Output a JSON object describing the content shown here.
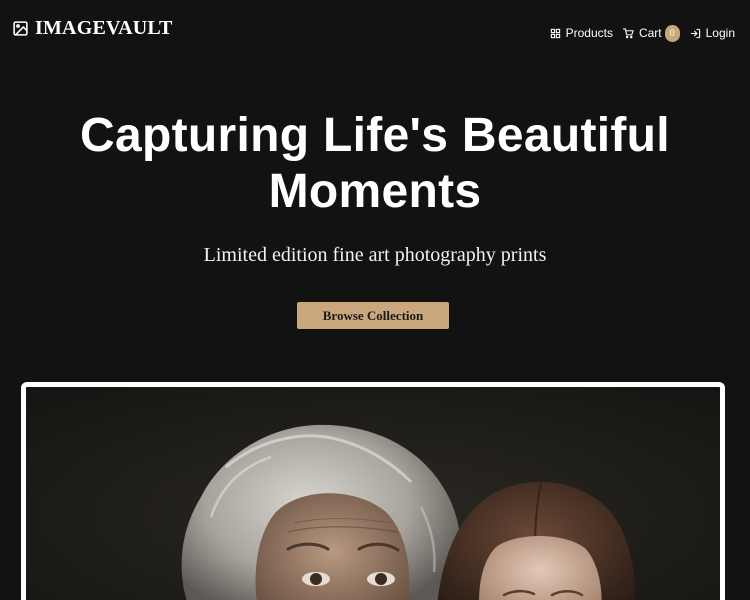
{
  "brand": {
    "name": "IMAGEVAULT",
    "logo_icon": "image-icon"
  },
  "nav": {
    "items": [
      {
        "label": "Products",
        "icon": "grid-icon"
      },
      {
        "label": "Cart",
        "icon": "cart-icon",
        "badge": "0"
      },
      {
        "label": "Login",
        "icon": "login-icon"
      }
    ]
  },
  "hero": {
    "title_line1": "Capturing Life's Beautiful",
    "title_line2": "Moments",
    "subtitle": "Limited edition fine art photography prints",
    "cta_label": "Browse Collection"
  },
  "colors": {
    "background": "#121212",
    "accent": "#caa67c",
    "text": "#ffffff"
  }
}
